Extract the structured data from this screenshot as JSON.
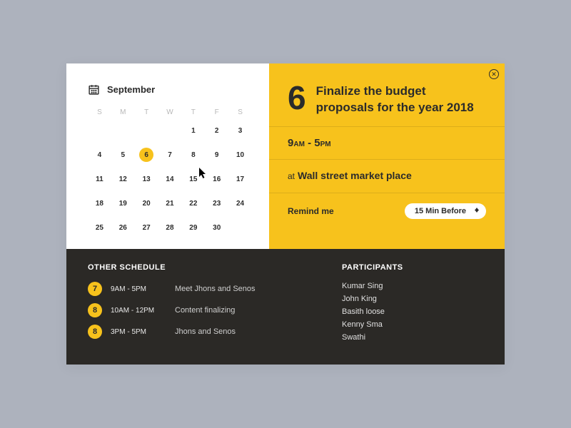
{
  "calendar": {
    "month": "September",
    "dow": [
      "S",
      "M",
      "T",
      "W",
      "T",
      "F",
      "S"
    ],
    "leading_blanks": 4,
    "days": 30,
    "selected": 6
  },
  "event": {
    "day": "6",
    "title": "Finalize the budget proposals for the year 2018",
    "time_start_num": "9",
    "time_start_ampm": "AM",
    "time_dash": " - ",
    "time_end_num": "5",
    "time_end_ampm": "PM",
    "location_prefix": "at",
    "location": "Wall street market place",
    "remind_label": "Remind me",
    "remind_value": "15 Min Before"
  },
  "other_schedule": {
    "title": "OTHER SCHEDULE",
    "items": [
      {
        "day": "7",
        "time": "9AM - 5PM",
        "desc": "Meet Jhons and Senos"
      },
      {
        "day": "8",
        "time": "10AM - 12PM",
        "desc": "Content finalizing"
      },
      {
        "day": "8",
        "time": "3PM - 5PM",
        "desc": "Jhons and Senos"
      }
    ]
  },
  "participants": {
    "title": "PARTICIPANTS",
    "list": [
      "Kumar Sing",
      "John King",
      "Basith loose",
      "Kenny Sma",
      "Swathi"
    ]
  }
}
